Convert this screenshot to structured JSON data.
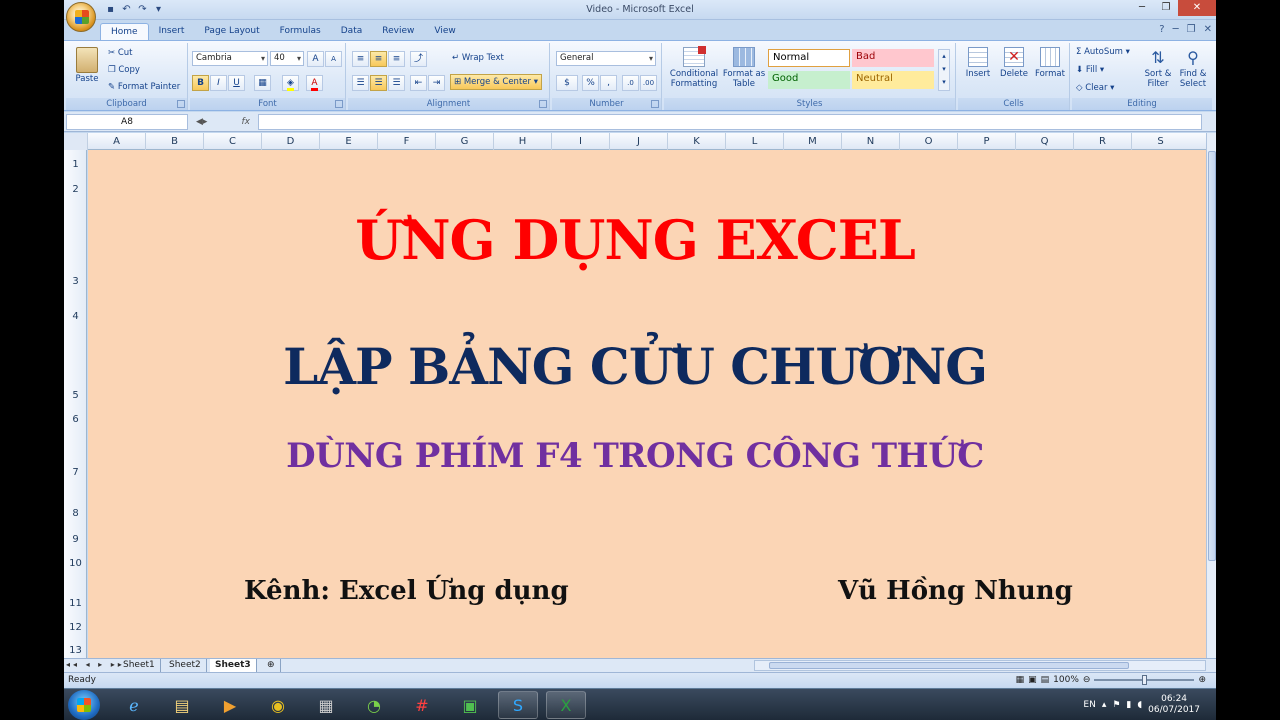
{
  "window": {
    "title": "Video - Microsoft Excel"
  },
  "tabs": [
    "Home",
    "Insert",
    "Page Layout",
    "Formulas",
    "Data",
    "Review",
    "View"
  ],
  "clipboard": {
    "paste": "Paste",
    "cut": "Cut",
    "copy": "Copy",
    "format_painter": "Format Painter",
    "label": "Clipboard"
  },
  "font": {
    "name": "Cambria",
    "size": "40",
    "bold": "B",
    "italic": "I",
    "underline": "U",
    "label": "Font"
  },
  "alignment": {
    "wrap_text": "Wrap Text",
    "merge_center": "Merge & Center",
    "label": "Alignment"
  },
  "number": {
    "format": "General",
    "percent": "%",
    "comma": ",",
    "label": "Number"
  },
  "styles": {
    "conditional": "Conditional Formatting",
    "format_table": "Format as Table",
    "normal": "Normal",
    "bad": "Bad",
    "good": "Good",
    "neutral": "Neutral",
    "label": "Styles"
  },
  "cells": {
    "insert": "Insert",
    "delete": "Delete",
    "format": "Format",
    "label": "Cells"
  },
  "editing": {
    "autosum": "AutoSum",
    "fill": "Fill",
    "clear": "Clear",
    "sort": "Sort & Filter",
    "find": "Find & Select",
    "label": "Editing"
  },
  "formula_bar": {
    "name_box": "A8",
    "fx": "fx",
    "value": ""
  },
  "columns": [
    "A",
    "B",
    "C",
    "D",
    "E",
    "F",
    "G",
    "H",
    "I",
    "J",
    "K",
    "L",
    "M",
    "N",
    "O",
    "P",
    "Q",
    "R",
    "S"
  ],
  "rows": [
    "1",
    "2",
    "3",
    "4",
    "5",
    "6",
    "7",
    "8",
    "9",
    "10",
    "11",
    "12",
    "13"
  ],
  "content": {
    "title": "ỨNG DỤNG EXCEL",
    "subtitle": "LẬP BẢNG CỬU CHƯƠNG",
    "topic": "DÙNG PHÍM F4 TRONG CÔNG THỨC",
    "channel": "Kênh: Excel Ứng dụng",
    "author": "Vũ Hồng Nhung"
  },
  "sheet_tabs": [
    "Sheet1",
    "Sheet2",
    "Sheet3"
  ],
  "active_sheet": "Sheet3",
  "status": {
    "text": "Ready",
    "zoom": "100%"
  },
  "taskbar": {
    "lang": "EN",
    "time": "06:24",
    "date": "06/07/2017"
  },
  "colors": {
    "sheet_bg": "#fbd5b5",
    "title": "#ff0000",
    "subtitle": "#0e2a5e",
    "topic": "#7030a0"
  }
}
